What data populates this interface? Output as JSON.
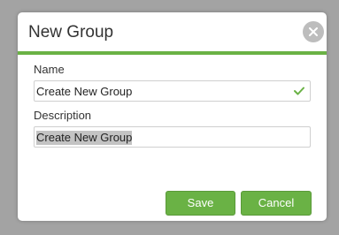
{
  "dialog": {
    "title": "New Group",
    "close_icon": "close-icon",
    "name_label": "Name",
    "name_value": "Create New Group",
    "name_valid_icon": "check-icon",
    "description_label": "Description",
    "description_value": "Create New Group",
    "save_label": "Save",
    "cancel_label": "Cancel"
  },
  "colors": {
    "accent": "#6ab245",
    "overlay": "#a3a3a3",
    "close_bg": "#bdbdbd",
    "selection": "#c3c3c3"
  }
}
